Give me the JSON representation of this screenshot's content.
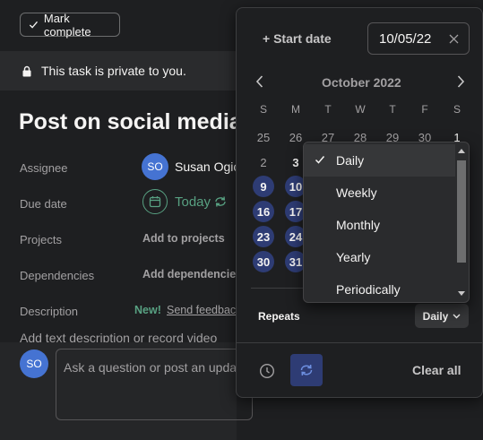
{
  "toolbar": {
    "mark_complete": "Mark complete"
  },
  "privacy": {
    "text": "This task is private to you."
  },
  "task": {
    "title": "Post on social media"
  },
  "fields": {
    "assignee_label": "Assignee",
    "assignee_initials": "SO",
    "assignee_name": "Susan Ogic",
    "due_label": "Due date",
    "due_value": "Today",
    "projects_label": "Projects",
    "projects_value": "Add to projects",
    "dependencies_label": "Dependencies",
    "dependencies_value": "Add dependencies",
    "description_label": "Description",
    "description_new": "New!",
    "description_feedback": "Send feedback",
    "description_placeholder": "Add text description or record video"
  },
  "comment": {
    "avatar_initials": "SO",
    "placeholder": "Ask a question or post an update..."
  },
  "date_picker": {
    "start_date_label": "+ Start date",
    "date_value": "10/05/22",
    "month_label": "October 2022",
    "weekdays": [
      "S",
      "M",
      "T",
      "W",
      "T",
      "F",
      "S"
    ],
    "weeks": [
      [
        "25",
        "26",
        "27",
        "28",
        "29",
        "30",
        "1"
      ],
      [
        "2",
        "3"
      ],
      [
        "9",
        "10"
      ],
      [
        "16",
        "17"
      ],
      [
        "23",
        "24"
      ],
      [
        "30",
        "31"
      ]
    ],
    "repeats_label": "Repeats",
    "repeats_value": "Daily",
    "clear_all": "Clear all"
  },
  "repeat_menu": {
    "options": [
      "Daily",
      "Weekly",
      "Monthly",
      "Yearly",
      "Periodically"
    ],
    "selected": "Daily"
  }
}
